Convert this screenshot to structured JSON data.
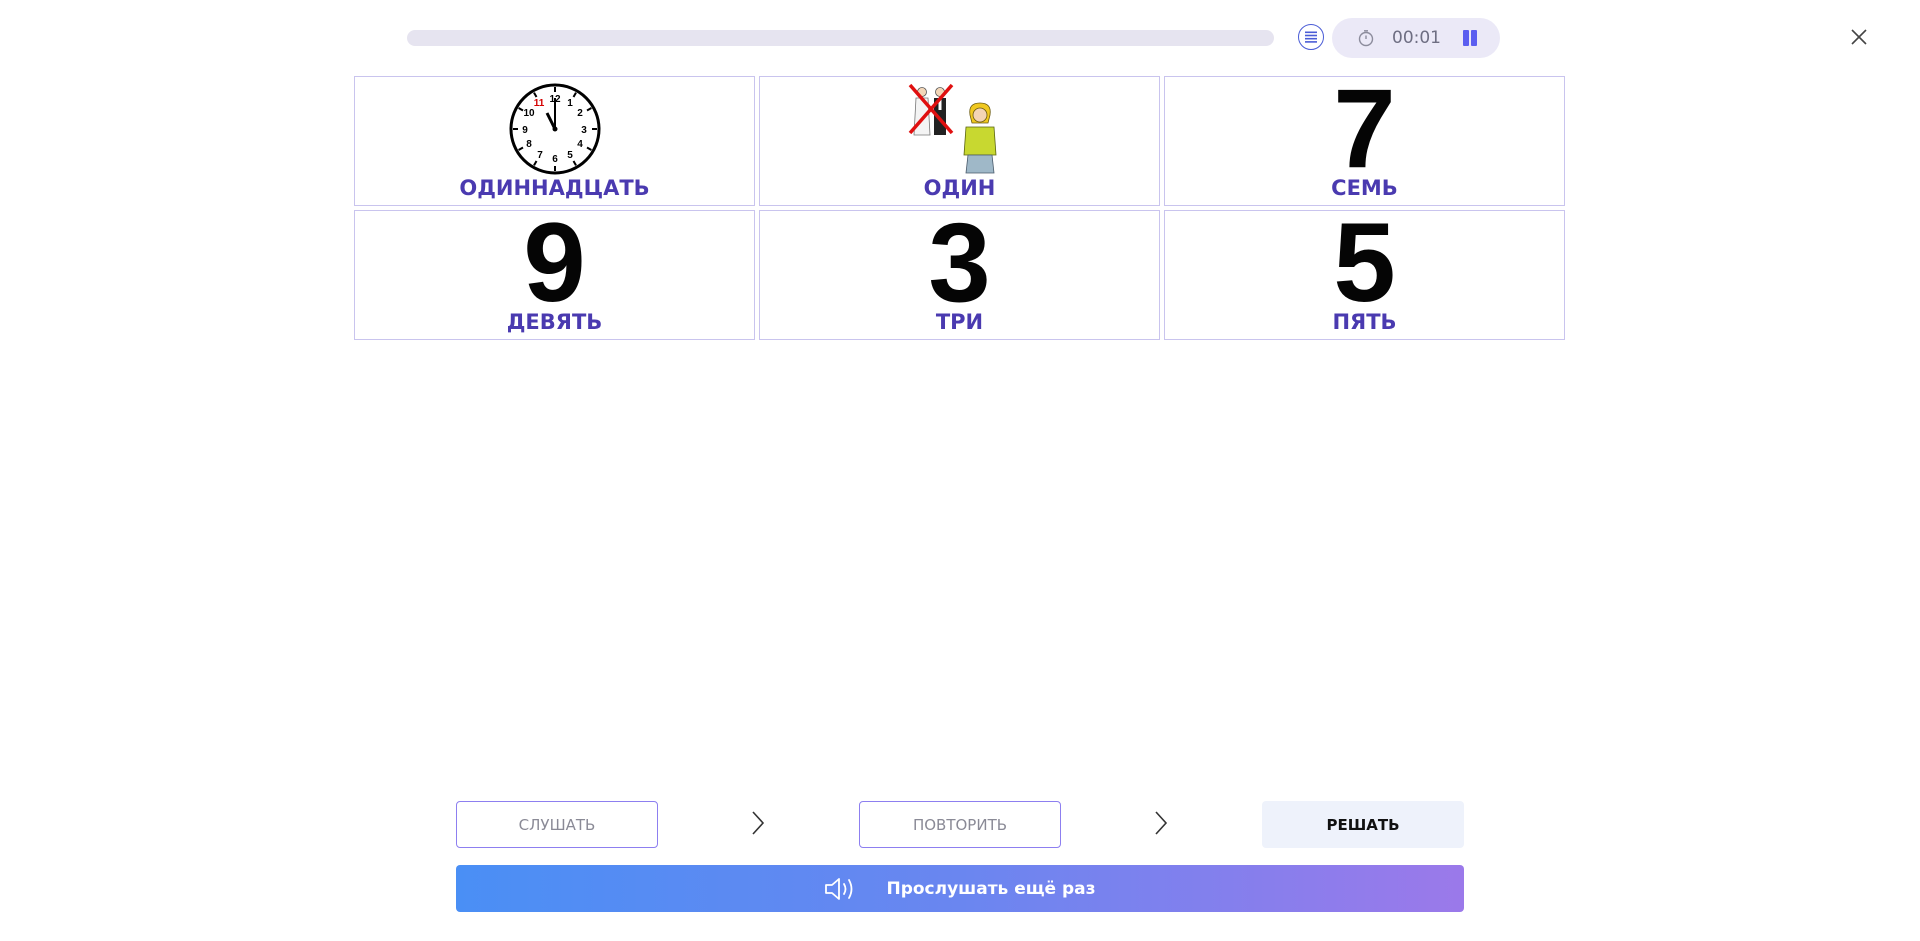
{
  "progress": {
    "fraction": 0.0
  },
  "timer": {
    "time": "00:01"
  },
  "icons": {
    "list": "list-icon",
    "stopwatch": "stopwatch-icon",
    "pause": "pause-icon",
    "close": "close-icon",
    "speaker": "speaker-icon",
    "chevron": "chevron-right-icon",
    "clock": "clock-icon",
    "people": "people-icon"
  },
  "cards": [
    {
      "label": "ОДИННАДЦАТЬ",
      "image": "clock-icon"
    },
    {
      "label": "ОДИН",
      "image": "people-icon"
    },
    {
      "label": "СЕМЬ",
      "digit": "7"
    },
    {
      "label": "ДЕВЯТЬ",
      "digit": "9"
    },
    {
      "label": "ТРИ",
      "digit": "3"
    },
    {
      "label": "ПЯТЬ",
      "digit": "5"
    }
  ],
  "steps": {
    "listen": "СЛУШАТЬ",
    "repeat": "ПОВТОРИТЬ",
    "solve": "РЕШАТЬ"
  },
  "listen_again": "Прослушать ещё раз",
  "colors": {
    "accent": "#5b5ef0",
    "label": "#4a3ab0",
    "card_border": "#c9c4ee",
    "gradient_start": "#4a8ff5",
    "gradient_end": "#9b79ea"
  }
}
